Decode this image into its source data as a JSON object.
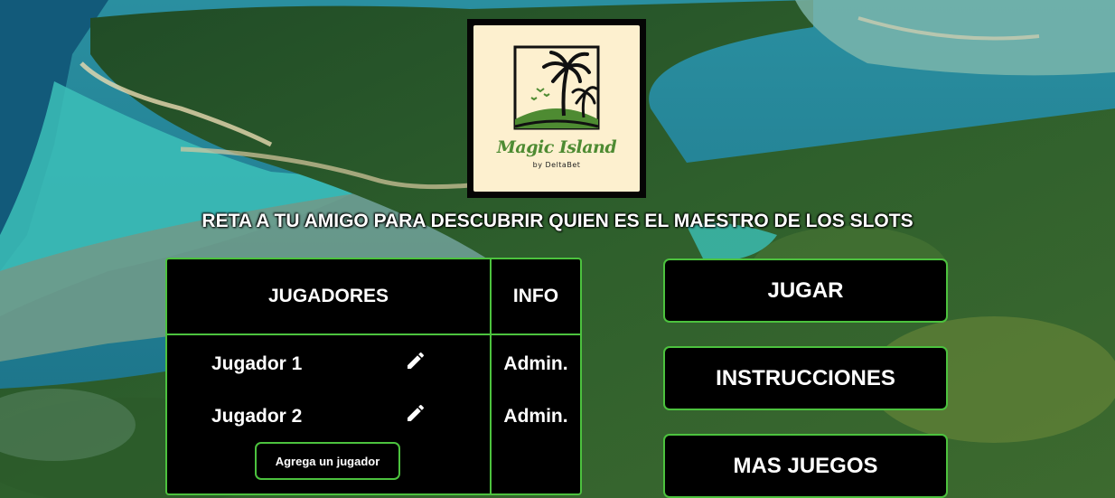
{
  "logo": {
    "title": "Magic Island",
    "subtitle": "by DeltaBet"
  },
  "tagline": "RETA A TU AMIGO PARA DESCUBRIR QUIEN ES EL MAESTRO DE LOS SLOTS",
  "table": {
    "headers": {
      "players": "JUGADORES",
      "info": "INFO"
    },
    "players": [
      {
        "name": "Jugador 1",
        "role": "Admin."
      },
      {
        "name": "Jugador 2",
        "role": "Admin."
      }
    ],
    "add_label": "Agrega un jugador"
  },
  "actions": {
    "play": "JUGAR",
    "instructions": "INSTRUCCIONES",
    "more_games": "MAS JUEGOS"
  },
  "colors": {
    "accent": "#4cc23e",
    "panel": "#000000",
    "logo_bg": "#fdf0cf",
    "logo_title": "#4e8b32"
  },
  "icons": {
    "edit": "pencil-icon",
    "logo_art": "palm-tree-island-icon"
  }
}
